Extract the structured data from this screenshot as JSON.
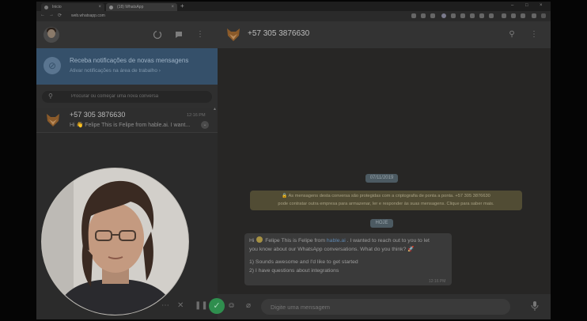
{
  "browser": {
    "tabs": [
      {
        "label": "Inicio"
      },
      {
        "label": "(18) WhatsApp"
      }
    ],
    "new_tab": "+",
    "window_controls": [
      "–",
      "□",
      "×"
    ],
    "nav": [
      "←",
      "→",
      "⟳"
    ],
    "url": "web.whatsapp.com"
  },
  "sidebar": {
    "header_icons": [
      "status-icon",
      "chat-icon",
      "menu-icon"
    ],
    "notification": {
      "title": "Receba notificações de novas mensagens",
      "link": "Ativar notificações na área de trabalho ›"
    },
    "search": {
      "placeholder": "Procurar ou começar uma nova conversa"
    },
    "chats": [
      {
        "name": "+57 305 3876630",
        "time": "12:16 PM",
        "preview": "Hi 👋 Felipe This is Felipe from hable.ai. I want..."
      }
    ]
  },
  "conversation": {
    "contact": "+57 305 3876630",
    "date_label": "07/11/2019",
    "encryption_notice": "🔒 As mensagens desta conversa são protegidas com a criptografia de ponta a ponta. +57 305 3876630 pode contratar outra empresa para armazenar, ler e responder às suas mensagens. Clique para saber mais.",
    "encryption_lines": [
      "🔒 As mensagens desta conversa são protegidas com a criptografia de ponta a ponta. +57 305 3876630",
      "pode contratar outra empresa para armazenar, ler e responder às suas mensagens. Clique para saber mais."
    ],
    "today_label": "HOJE",
    "message": {
      "line1_start": "Hi",
      "line1_mid": " Felipe This is Felipe from ",
      "link": "hable.ai",
      "line1_end": ". I wanted to reach out to you to let",
      "line2": "you know about our WhatsApp conversations. What do you think? 🚀",
      "option1": "1)   Sounds awesome and I'd like to get started",
      "option2": "2)   I have questions about integrations",
      "time": "12:16 PM"
    },
    "compose_placeholder": "Digite uma mensagem"
  },
  "colors": {
    "accent": "#2f8e4e",
    "notification_bg": "#35506a",
    "link": "#5e87b0"
  }
}
